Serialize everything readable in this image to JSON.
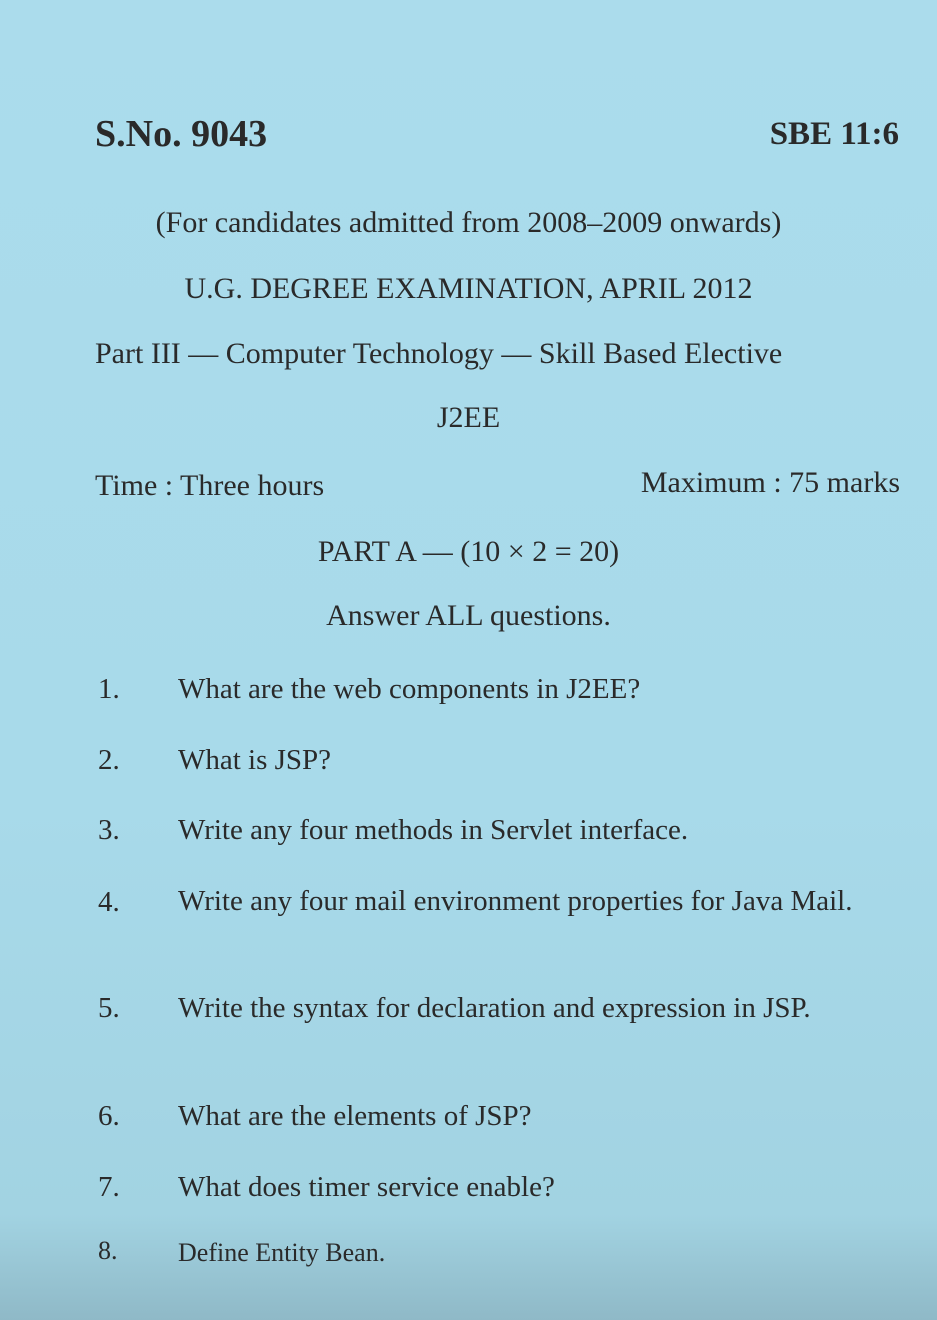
{
  "header": {
    "serial_number": "S.No. 9043",
    "subject_code": "SBE 11:6"
  },
  "exam": {
    "eligibility": "(For candidates admitted from 2008–2009 onwards)",
    "title": "U.G. DEGREE EXAMINATION, APRIL 2012",
    "course": "Part III — Computer Technology — Skill Based Elective",
    "subject": "J2EE",
    "time": "Time : Three hours",
    "max_marks": "Maximum : 75 marks"
  },
  "part_a": {
    "heading": "PART A — (10 × 2 = 20)",
    "instruction": "Answer ALL questions.",
    "questions": [
      {
        "number": "1.",
        "text": "What are the web components in J2EE?"
      },
      {
        "number": "2.",
        "text": "What is JSP?"
      },
      {
        "number": "3.",
        "text": "Write any four methods in Servlet interface."
      },
      {
        "number": "4.",
        "text": "Write any four mail environment properties for Java Mail."
      },
      {
        "number": "5.",
        "text": "Write the syntax for declaration and expression in JSP."
      },
      {
        "number": "6.",
        "text": "What are the elements of JSP?"
      },
      {
        "number": "7.",
        "text": "What does timer service enable?"
      },
      {
        "number": "8.",
        "text": "Define Entity Bean."
      }
    ]
  }
}
